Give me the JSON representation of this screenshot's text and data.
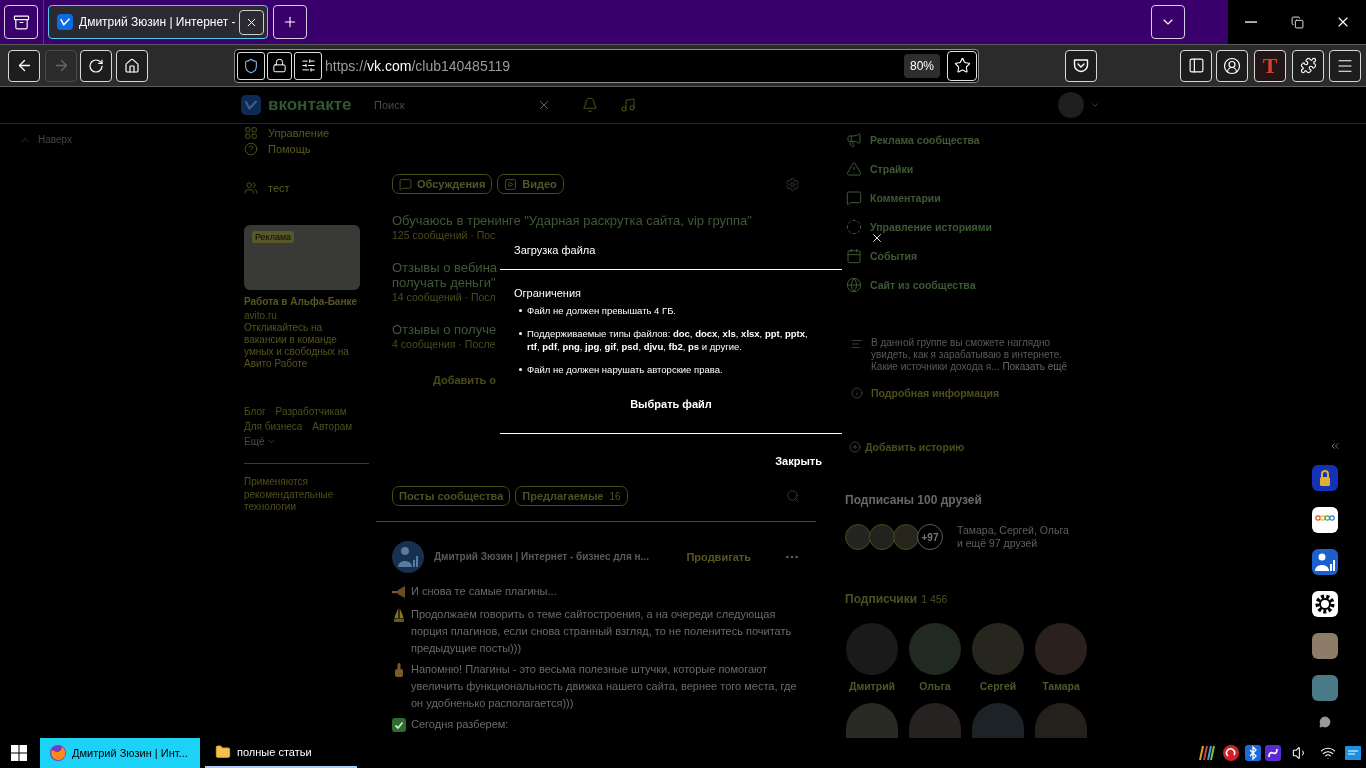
{
  "browser": {
    "tabs": [
      {
        "title": "Дмитрий Зюзин | Интернет -",
        "selected": true
      }
    ],
    "nav": {
      "back": {
        "disabled": false
      },
      "forward": {
        "disabled": true
      }
    },
    "url": {
      "scheme": "https://",
      "host": "vk.com",
      "path": "/club140485119"
    },
    "zoom": "80%",
    "extension_badge": "T"
  },
  "vk_header": {
    "logo": "вконтакте",
    "search_placeholder": "Поиск"
  },
  "back_to_top": "Наверх",
  "left_menu": [
    {
      "label": "Управление"
    },
    {
      "label": "Помощь"
    },
    {
      "label": "тест"
    }
  ],
  "ad": {
    "badge": "Реклама",
    "title": "Работа в Альфа-Банке",
    "domain": "avito.ru",
    "text": "Откликайтесь на вакансии в команде умных и свободных на Авито Работе"
  },
  "footer": {
    "links": [
      {
        "label": "Блог"
      },
      {
        "label": "Разработчикам"
      },
      {
        "label": "Для бизнеса"
      },
      {
        "label": "Авторам"
      }
    ],
    "more": "Ещё",
    "note": "Применяются рекомендательные технологии"
  },
  "content_tabs": [
    {
      "label": "Обсуждения"
    },
    {
      "label": "Видео"
    }
  ],
  "discussions": [
    {
      "title_lines": [
        "Обучаюсь в тренинге \"Ударная раскрутка сайта, vip группа\""
      ],
      "meta": "125 сообщений · Пос"
    },
    {
      "title_lines": [
        "Отзывы о вебина",
        "получать деньги\""
      ],
      "meta": "14 сообщений · Посл"
    },
    {
      "title_lines": [
        "Отзывы о получе"
      ],
      "meta": "4 сообщения · После"
    }
  ],
  "add_discussion": "Добавить о",
  "wall_tabs": [
    {
      "label": "Посты сообщества"
    },
    {
      "label": "Предлагаемые",
      "count": "16"
    }
  ],
  "post": {
    "author": "Дмитрий Зюзин | Интернет - бизнес для н...",
    "action": "Продвигать",
    "paragraphs": [
      "И снова те самые плагины...",
      "Продолжаем говорить о теме сайтостроения, а на очереди следующая порция плагинов, если снова странный взгляд, то не поленитесь почитать предыдущие посты)))",
      "Напомню! Плагины - это весьма полезные штучки, которые помогают увеличить функциональность движка нашего сайта, вернее того места, где он удобненько располагается)))",
      "Сегодня разберем:"
    ]
  },
  "community_menu": [
    {
      "label": "Реклама сообщества"
    },
    {
      "label": "Страйки"
    },
    {
      "label": "Комментарии"
    },
    {
      "label": "Управление историями"
    },
    {
      "label": "События"
    },
    {
      "label": "Сайт из сообщества"
    }
  ],
  "about": {
    "text": "В данной группе вы сможете наглядно увидеть, как я зарабатываю в интернете. Какие источники дохода я...",
    "more": "Показать ещё",
    "details": "Подробная информация"
  },
  "add_story": "Добавить историю",
  "friends": {
    "title": "Подписаны 100 друзей",
    "more": "+97",
    "names": "Тамара, Сергей, Ольга",
    "rest": "и ещё 97 друзей"
  },
  "subscribers": {
    "title": "Подписчики",
    "count": "1 456",
    "members": [
      {
        "name": "Дмитрий"
      },
      {
        "name": "Ольга"
      },
      {
        "name": "Сергей"
      },
      {
        "name": "Тамара"
      }
    ]
  },
  "upload_dialog": {
    "title": "Загрузка файла",
    "section": "Ограничения",
    "rules": [
      "Файл не должен превышать 4 ГБ.",
      "Поддерживаемые типы файлов: **doc**, **docx**, **xls**, **xlsx**, **ppt**, **pptx**, **rtf**, **pdf**, **png**, **jpg**, **gif**, **psd**, **djvu**, **fb2**, **ps** и другие.",
      "Файл не должен нарушать авторские права."
    ],
    "choose_button": "Выбрать файл",
    "close_button": "Закрыть"
  },
  "taskbar": {
    "items": [
      {
        "title": "Дмитрий Зюзин | Инт...",
        "selected": true
      },
      {
        "title": "полные статьи",
        "selected": false
      }
    ]
  }
}
